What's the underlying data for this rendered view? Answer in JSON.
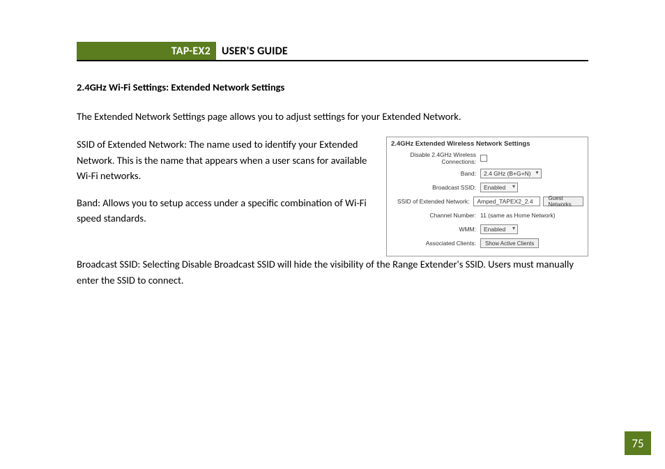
{
  "header": {
    "product": "TAP-EX2",
    "guide": "USER'S GUIDE"
  },
  "section_title": "2.4GHz Wi-Fi Settings: Extended Network Settings",
  "intro": "The Extended Network Settings page allows you to adjust settings for your Extended Network.",
  "paragraphs": {
    "ssid": "SSID of Extended Network: The name used to identify your Extended Network. This is the name that appears when a user scans for available Wi-Fi networks.",
    "band": "Band: Allows you to setup access under a specific combination of Wi-Fi speed standards.",
    "broadcast": "Broadcast SSID: Selecting Disable Broadcast SSID will hide the visibility of the Range Extender's SSID. Users must manually enter the SSID to connect."
  },
  "panel": {
    "title": "2.4GHz Extended Wireless Network Settings",
    "rows": {
      "disable_label": "Disable 2.4GHz Wireless Connections:",
      "band_label": "Band:",
      "band_value": "2.4 GHz (B+G+N)",
      "broadcast_label": "Broadcast SSID:",
      "broadcast_value": "Enabled",
      "ssid_label": "SSID of Extended Network:",
      "ssid_value": "Amped_TAPEX2_2.4",
      "guest_btn": "Guest Networks",
      "channel_label": "Channel Number:",
      "channel_value": "11 (same as Home Network)",
      "wmm_label": "WMM:",
      "wmm_value": "Enabled",
      "clients_label": "Associated Clients:",
      "clients_btn": "Show Active Clients"
    }
  },
  "page_number": "75"
}
